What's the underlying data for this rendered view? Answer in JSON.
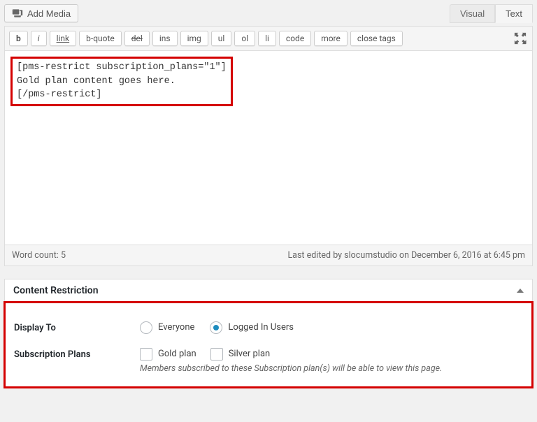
{
  "media": {
    "add_label": "Add Media"
  },
  "tabs": {
    "visual": "Visual",
    "text": "Text"
  },
  "quicktags": {
    "b": "b",
    "i": "i",
    "link": "link",
    "bquote": "b-quote",
    "del": "del",
    "ins": "ins",
    "img": "img",
    "ul": "ul",
    "ol": "ol",
    "li": "li",
    "code": "code",
    "more": "more",
    "close": "close tags"
  },
  "editor": {
    "line1": "[pms-restrict subscription_plans=\"1\"]",
    "line2": "Gold plan content goes here.",
    "line3": "[/pms-restrict]"
  },
  "status": {
    "wordcount": "Word count: 5",
    "lastedit": "Last edited by slocumstudio on December 6, 2016 at 6:45 pm"
  },
  "restriction": {
    "title": "Content Restriction",
    "display_to_label": "Display To",
    "everyone": "Everyone",
    "logged_in": "Logged In Users",
    "plans_label": "Subscription Plans",
    "gold": "Gold plan",
    "silver": "Silver plan",
    "desc": "Members subscribed to these Subscription plan(s) will be able to view this page."
  }
}
